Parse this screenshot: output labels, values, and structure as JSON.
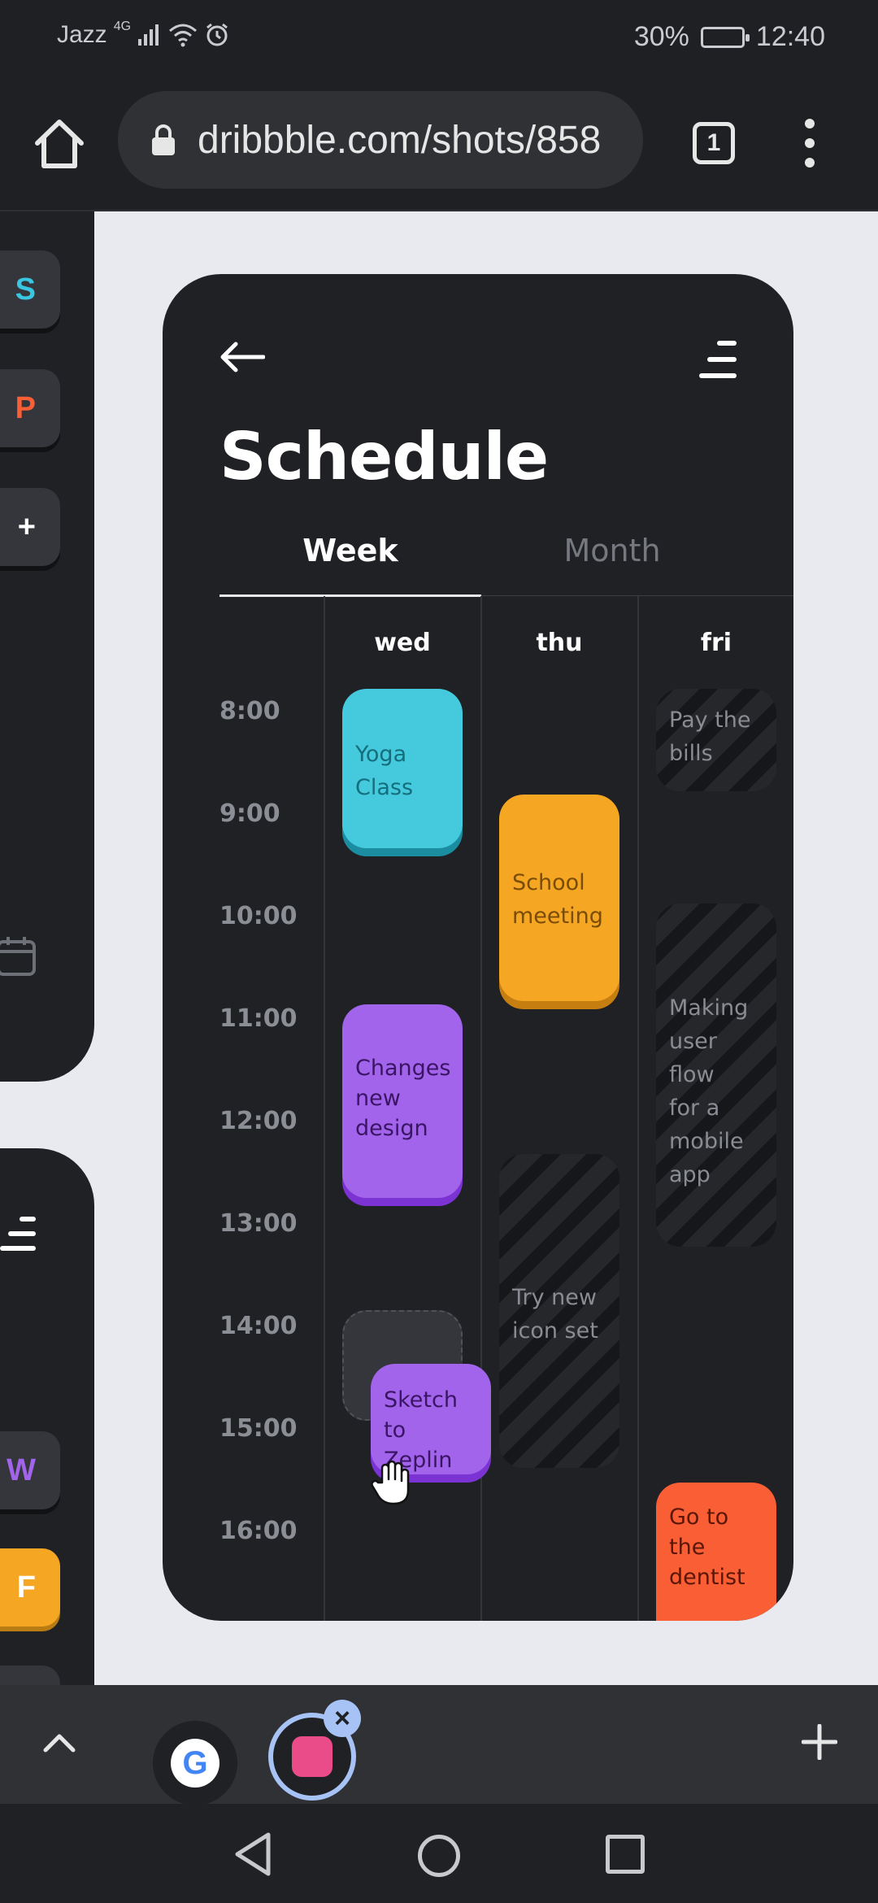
{
  "status_bar": {
    "carrier": "Jazz",
    "network": "4G",
    "battery": "30%",
    "time": "12:40"
  },
  "browser": {
    "url": "dribbble.com/shots/858",
    "tab_count": "1"
  },
  "sidebar": {
    "apps": [
      {
        "letter": "S",
        "color": "#3ac5e0"
      },
      {
        "letter": "P",
        "color": "#f95e35"
      },
      {
        "letter": "+",
        "color": "#ffffff"
      },
      {
        "letter": "W",
        "color": "#a264ea"
      },
      {
        "letter": "F",
        "color": "#ffffff",
        "bg": "#f5a623"
      }
    ]
  },
  "schedule": {
    "title": "Schedule",
    "tabs": [
      "Week",
      "Month"
    ],
    "active_tab": "Week",
    "days": [
      "wed",
      "thu",
      "fri"
    ],
    "times": [
      "8:00",
      "9:00",
      "10:00",
      "11:00",
      "12:00",
      "13:00",
      "14:00",
      "15:00",
      "16:00"
    ],
    "events": [
      {
        "day": "wed",
        "label": "Yoga Class",
        "lines": [
          "Yoga",
          "Class"
        ],
        "style": "teal",
        "color": "#45c9dd"
      },
      {
        "day": "wed",
        "label": "Changes new design",
        "lines": [
          "Changes",
          "new",
          "design"
        ],
        "style": "purple",
        "color": "#a264ea"
      },
      {
        "day": "wed",
        "label": "Sketch to Zeplin",
        "lines": [
          "Sketch",
          "to Zeplin"
        ],
        "style": "purple-dragging",
        "color": "#a264ea"
      },
      {
        "day": "thu",
        "label": "School meeting",
        "lines": [
          "School",
          "meeting"
        ],
        "style": "orange",
        "color": "#f5a623"
      },
      {
        "day": "thu",
        "label": "Try new icon set",
        "lines": [
          "Try new",
          "icon set"
        ],
        "style": "striped"
      },
      {
        "day": "fri",
        "label": "Pay the bills",
        "lines": [
          "Pay the",
          "bills"
        ],
        "style": "striped"
      },
      {
        "day": "fri",
        "label": "Making user flow for a mobile app",
        "lines": [
          "Making",
          "user flow",
          "for a",
          "mobile",
          "app"
        ],
        "style": "striped"
      },
      {
        "day": "fri",
        "label": "Go to the dentist",
        "lines": [
          "Go to",
          "the",
          "dentist"
        ],
        "style": "red",
        "color": "#f95e35"
      }
    ]
  },
  "tab_bar": {
    "google_tab": "G"
  }
}
